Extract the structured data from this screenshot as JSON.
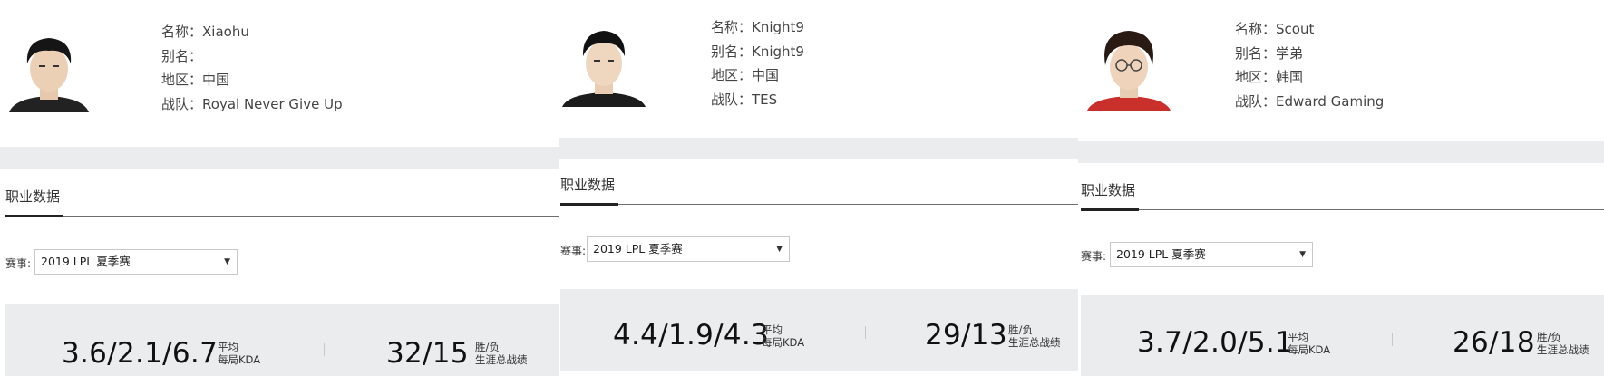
{
  "section_title": "职业数据",
  "filter_label": "赛事:",
  "kda_caption_line1": "平均",
  "kda_caption_line2": "每局KDA",
  "record_caption_line1": "胜/负",
  "record_caption_line2": "生涯总战绩",
  "info_labels": {
    "name": "名称：",
    "alias": "别名：",
    "region": "地区：",
    "team": "战队："
  },
  "players": [
    {
      "name": "Xiaohu",
      "alias": "",
      "region": "中国",
      "team": "Royal Never Give Up",
      "season": "2019 LPL 夏季赛",
      "kda": "3.6/2.1/6.7",
      "record": "32/15",
      "jersey_color": "#222222"
    },
    {
      "name": "Knight9",
      "alias": "Knight9",
      "region": "中国",
      "team": "TES",
      "season": "2019 LPL 夏季赛",
      "kda": "4.4/1.9/4.3",
      "record": "29/13",
      "jersey_color": "#1c1c1c"
    },
    {
      "name": "Scout",
      "alias": "学弟",
      "region": "韩国",
      "team": "Edward Gaming",
      "season": "2019 LPL 夏季赛",
      "kda": "3.7/2.0/5.1",
      "record": "26/18",
      "jersey_color": "#c9302c"
    }
  ],
  "icons": {
    "avatar": "player-portrait",
    "select_caret": "caret-down-icon"
  }
}
